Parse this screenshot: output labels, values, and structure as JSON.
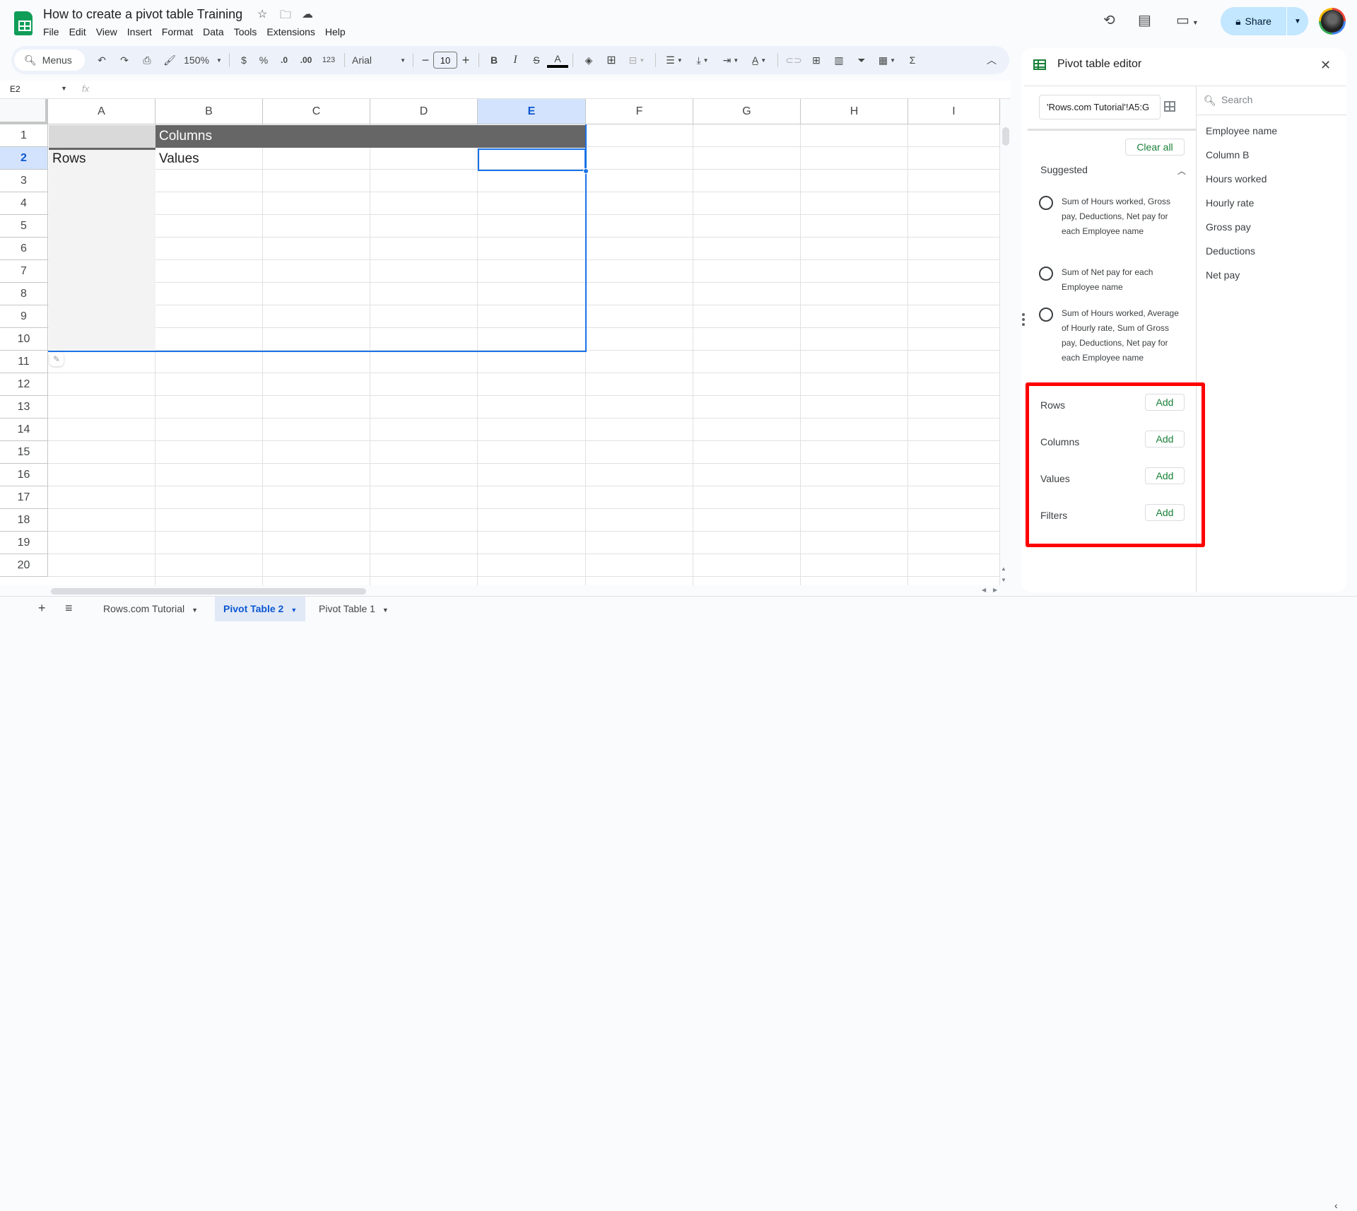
{
  "app": {
    "doc_title": "How to create a pivot table Training",
    "menu": [
      "File",
      "Edit",
      "View",
      "Insert",
      "Format",
      "Data",
      "Tools",
      "Extensions",
      "Help"
    ],
    "share_label": "Share",
    "brand_color": "#0f9d58"
  },
  "toolbar": {
    "menus_search": "Menus",
    "zoom": "150%",
    "currency": "$",
    "percent": "%",
    "decrease_decimal": ".0",
    "increase_decimal": ".00",
    "number_format": "123",
    "font": "Arial",
    "font_size": "10"
  },
  "formula_bar": {
    "cell_ref": "E2",
    "fx": "fx",
    "value": ""
  },
  "grid": {
    "columns": [
      "A",
      "B",
      "C",
      "D",
      "E",
      "F",
      "G",
      "H",
      "I"
    ],
    "selected_column": "E",
    "rows": [
      "1",
      "2",
      "3",
      "4",
      "5",
      "6",
      "7",
      "8",
      "9",
      "10",
      "11",
      "12",
      "13",
      "14",
      "15",
      "16",
      "17",
      "18",
      "19",
      "20"
    ],
    "selected_row": "2",
    "pivot_placeholder": {
      "columns_label": "Columns",
      "rows_label": "Rows",
      "values_label": "Values"
    }
  },
  "sheet_tabs": [
    {
      "label": "Rows.com Tutorial",
      "active": false
    },
    {
      "label": "Pivot Table 2",
      "active": true
    },
    {
      "label": "Pivot Table 1",
      "active": false
    }
  ],
  "pivot_editor": {
    "title": "Pivot table editor",
    "data_range": "'Rows.com Tutorial'!A5:G",
    "clear_all": "Clear all",
    "suggested_label": "Suggested",
    "suggestions": [
      "Sum of Hours worked, Gross pay, Deductions, Net pay for each Employee name",
      "Sum of Net pay for each Employee name",
      "Sum of Hours worked, Average of Hourly rate, Sum of Gross pay, Deductions, Net pay for each Employee name"
    ],
    "sections": [
      {
        "label": "Rows",
        "button": "Add"
      },
      {
        "label": "Columns",
        "button": "Add"
      },
      {
        "label": "Values",
        "button": "Add"
      },
      {
        "label": "Filters",
        "button": "Add"
      }
    ],
    "field_search_placeholder": "Search",
    "fields": [
      "Employee name",
      "Column B",
      "Hours worked",
      "Hourly rate",
      "Gross pay",
      "Deductions",
      "Net pay"
    ],
    "highlight_color": "#ff0000",
    "accent_color": "#188038"
  }
}
